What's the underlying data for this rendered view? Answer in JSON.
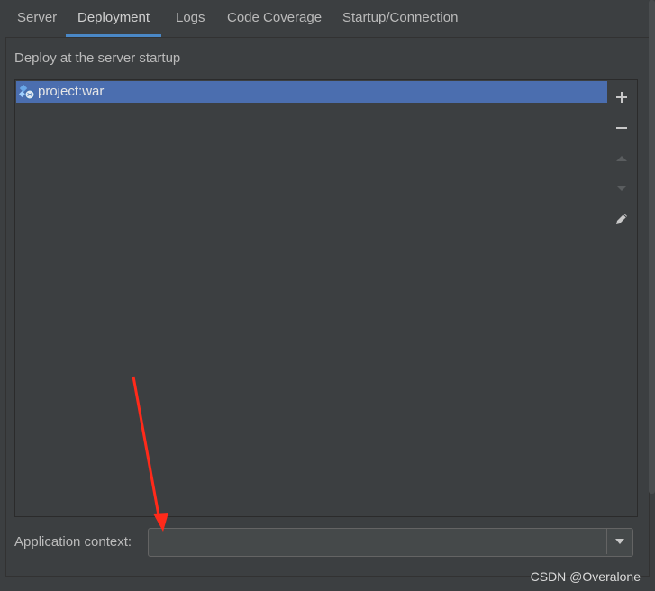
{
  "tabs": [
    {
      "label": "Server"
    },
    {
      "label": "Deployment"
    },
    {
      "label": "Logs"
    },
    {
      "label": "Code Coverage"
    },
    {
      "label": "Startup/Connection"
    }
  ],
  "active_tab": "Deployment",
  "deploy_section": {
    "title": "Deploy at the server startup",
    "items": [
      {
        "label": "project:war",
        "icon": "war-artifact-icon",
        "selected": true
      }
    ],
    "toolbar": [
      {
        "name": "add-icon",
        "enabled": true
      },
      {
        "name": "remove-icon",
        "enabled": true
      },
      {
        "name": "move-up-icon",
        "enabled": false
      },
      {
        "name": "move-down-icon",
        "enabled": false
      },
      {
        "name": "edit-icon",
        "enabled": true
      }
    ]
  },
  "application_context": {
    "label": "Application context:",
    "value": ""
  },
  "colors": {
    "background": "#3c3f41",
    "selection": "#4b6eaf",
    "tab_underline": "#4a88c7",
    "annotation_arrow": "#ff2a1a"
  },
  "watermark": "CSDN @Overalone"
}
